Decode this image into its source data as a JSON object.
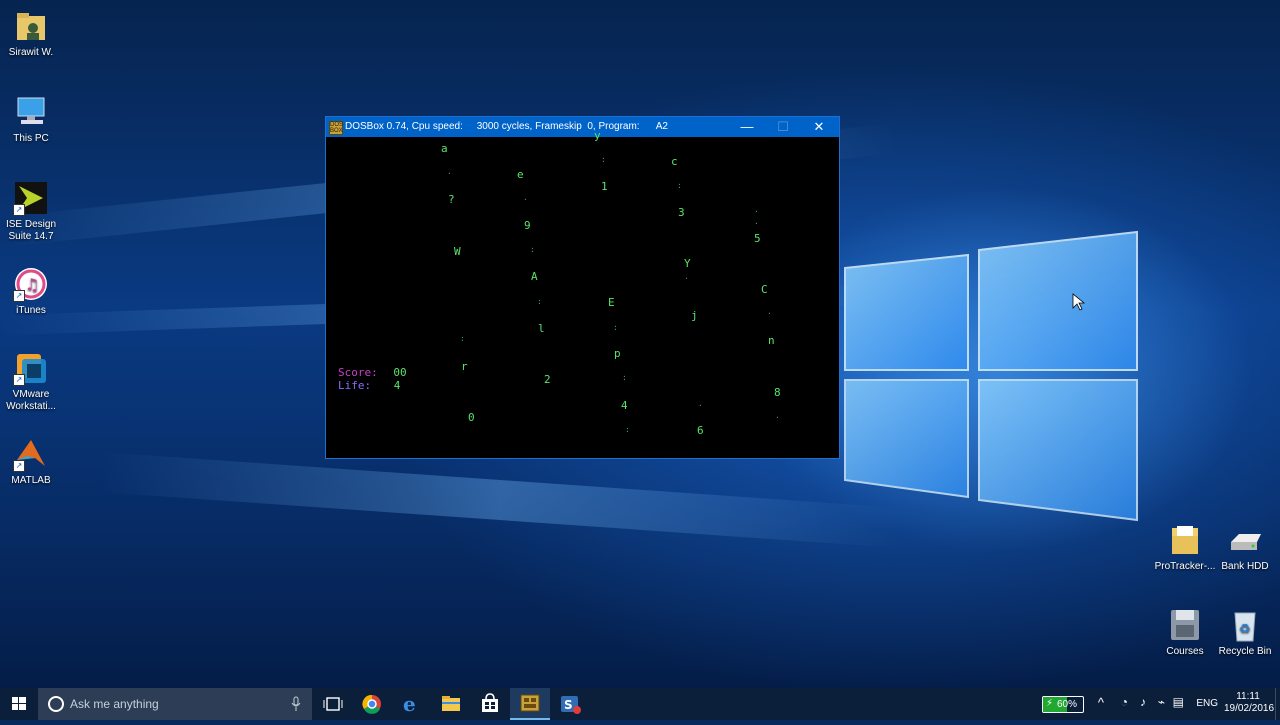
{
  "desktop": {
    "icons_left": [
      {
        "label": "Sirawit W.",
        "icon": "user-folder-icon"
      },
      {
        "label": "This PC",
        "icon": "computer-icon"
      },
      {
        "label": "ISE Design Suite 14.7",
        "icon": "ise-design-icon"
      },
      {
        "label": "iTunes",
        "icon": "itunes-icon"
      },
      {
        "label": "VMware Workstati...",
        "icon": "vmware-icon"
      },
      {
        "label": "MATLAB",
        "icon": "matlab-icon"
      }
    ],
    "icons_right": [
      {
        "label": "ProTracker-...",
        "icon": "folder-icon"
      },
      {
        "label": "Bank HDD",
        "icon": "drive-icon"
      },
      {
        "label": "Courses",
        "icon": "floppy-icon"
      },
      {
        "label": "Recycle Bin",
        "icon": "recycle-bin-icon"
      }
    ]
  },
  "dosbox": {
    "icon_text": "DOS BOX",
    "title": "DOSBox 0.74, Cpu speed:     3000 cycles, Frameskip  0, Program:      A2",
    "minimize": "—",
    "maximize": "☐",
    "close": "✕",
    "score_label": "Score:",
    "score_value": "00",
    "life_label": "Life:",
    "life_value": "4",
    "colors": {
      "score_label": "#c642c6",
      "life_label": "#8a6bff",
      "value": "#59e36a",
      "glyph": "#59e36a"
    },
    "glyphs": [
      "a",
      "y",
      "c",
      "e",
      "1",
      "?",
      "3",
      "9",
      "5",
      "W",
      "Y",
      "A",
      "C",
      "E",
      "j",
      "l",
      "n",
      "p",
      "r",
      "2",
      "8",
      "4",
      "0",
      "6"
    ]
  },
  "taskbar": {
    "search_placeholder": "Ask me anything",
    "apps": [
      "task-view-icon",
      "chrome-icon",
      "edge-icon",
      "file-explorer-icon",
      "store-icon",
      "dosbox-icon",
      "snagit-icon"
    ],
    "battery": "60%",
    "language": "ENG",
    "time": "11:11",
    "date": "19/02/2016"
  }
}
